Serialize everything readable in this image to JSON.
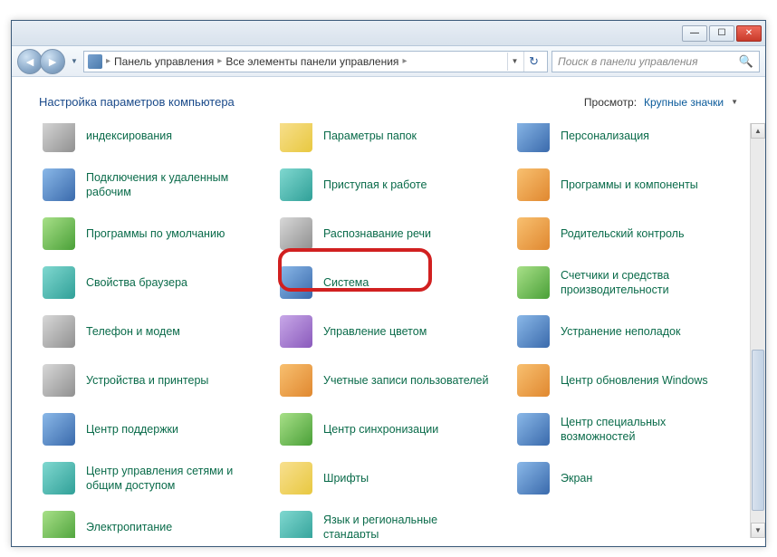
{
  "titlebar": {
    "min": "—",
    "max": "☐",
    "close": "✕"
  },
  "nav": {
    "back_glyph": "◄",
    "fwd_glyph": "►",
    "drop_glyph": "▼"
  },
  "address": {
    "seg1": "Панель управления",
    "seg2": "Все элементы панели управления",
    "sep": "▸",
    "refresh": "↻"
  },
  "search": {
    "placeholder": "Поиск в панели управления",
    "mag": "🔍"
  },
  "header": {
    "title": "Настройка параметров компьютера",
    "view_label": "Просмотр:",
    "view_value": "Крупные значки",
    "view_arrow": "▼"
  },
  "scrollbar": {
    "up": "▲",
    "down": "▼"
  },
  "items": [
    {
      "label": "индексирования",
      "icon": "gray",
      "name": "indexing"
    },
    {
      "label": "Параметры папок",
      "icon": "yellow",
      "name": "folder-options"
    },
    {
      "label": "Персонализация",
      "icon": "blue",
      "name": "personalization"
    },
    {
      "label": "Подключения к удаленным рабочим",
      "icon": "blue",
      "name": "remote-connections"
    },
    {
      "label": "Приступая к работе",
      "icon": "teal",
      "name": "getting-started"
    },
    {
      "label": "Программы и компоненты",
      "icon": "orange",
      "name": "programs-features"
    },
    {
      "label": "Программы по умолчанию",
      "icon": "green",
      "name": "default-programs"
    },
    {
      "label": "Распознавание речи",
      "icon": "gray",
      "name": "speech-recognition"
    },
    {
      "label": "Родительский контроль",
      "icon": "orange",
      "name": "parental-controls"
    },
    {
      "label": "Свойства браузера",
      "icon": "teal",
      "name": "internet-options"
    },
    {
      "label": "Система",
      "icon": "blue",
      "name": "system"
    },
    {
      "label": "Счетчики и средства производительности",
      "icon": "green",
      "name": "performance"
    },
    {
      "label": "Телефон и модем",
      "icon": "gray",
      "name": "phone-modem"
    },
    {
      "label": "Управление цветом",
      "icon": "purple",
      "name": "color-management"
    },
    {
      "label": "Устранение неполадок",
      "icon": "blue",
      "name": "troubleshooting"
    },
    {
      "label": "Устройства и принтеры",
      "icon": "gray",
      "name": "devices-printers"
    },
    {
      "label": "Учетные записи пользователей",
      "icon": "orange",
      "name": "user-accounts"
    },
    {
      "label": "Центр обновления Windows",
      "icon": "orange",
      "name": "windows-update"
    },
    {
      "label": "Центр поддержки",
      "icon": "blue",
      "name": "action-center"
    },
    {
      "label": "Центр синхронизации",
      "icon": "green",
      "name": "sync-center"
    },
    {
      "label": "Центр специальных возможностей",
      "icon": "blue",
      "name": "ease-of-access"
    },
    {
      "label": "Центр управления сетями и общим доступом",
      "icon": "teal",
      "name": "network-sharing"
    },
    {
      "label": "Шрифты",
      "icon": "yellow",
      "name": "fonts"
    },
    {
      "label": "Экран",
      "icon": "blue",
      "name": "display"
    },
    {
      "label": "Электропитание",
      "icon": "green",
      "name": "power-options"
    },
    {
      "label": "Язык и региональные стандарты",
      "icon": "teal",
      "name": "region-language"
    }
  ]
}
